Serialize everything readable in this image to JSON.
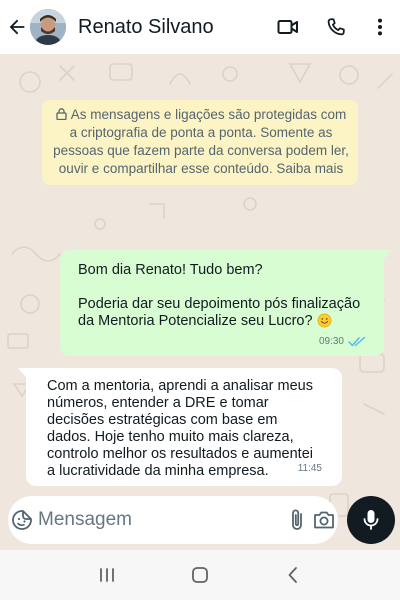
{
  "header": {
    "contact_name": "Renato Silvano",
    "icons": [
      "back-arrow-icon",
      "video-call-icon",
      "phone-icon",
      "more-vertical-icon"
    ]
  },
  "chat": {
    "encryption_notice": "As mensagens e ligações são protegidas com a criptografia de ponta a ponta. Somente as pessoas que fazem parte da conversa podem ler, ouvir e compartilhar esse conteúdo. Saiba mais",
    "messages": [
      {
        "direction": "outgoing",
        "lines": [
          "Bom dia Renato! Tudo bem?",
          "Poderia dar seu depoimento pós finalização da Mentoria Potencialize seu Lucro?"
        ],
        "emoji": "smiling-face",
        "time": "09:30",
        "status": "read"
      },
      {
        "direction": "incoming",
        "text": "Com a mentoria, aprendi a analisar meus números, entender a DRE e tomar decisões estratégicas com base em dados. Hoje tenho muito mais clareza, controlo melhor os resultados e aumentei a lucratividade da minha empresa.",
        "time": "11:45"
      }
    ]
  },
  "composer": {
    "placeholder": "Mensagem",
    "icons": [
      "sticker-icon",
      "attach-icon",
      "camera-icon",
      "mic-icon"
    ]
  },
  "colors": {
    "chat_bg": "#efe7dd",
    "outgoing_bubble": "#d9fdd3",
    "incoming_bubble": "#ffffff",
    "notice_bg": "#fdf4c5",
    "read_ticks": "#53bdeb",
    "mic_button": "#111b21"
  }
}
